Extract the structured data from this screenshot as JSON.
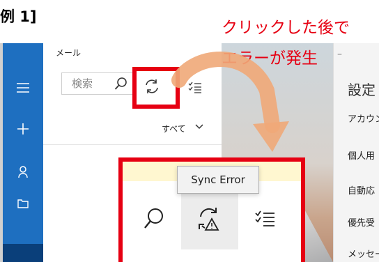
{
  "heading": {
    "text": "例 1]"
  },
  "annotation": {
    "line1": "クリックした後で",
    "line2": "エラーが発生"
  },
  "app": {
    "name": "メール",
    "search": {
      "placeholder": "検索"
    },
    "filter": {
      "label": "すべて"
    }
  },
  "rail": {
    "items": [
      {
        "icon": "hamburger-menu-icon"
      },
      {
        "icon": "plus-icon"
      },
      {
        "icon": "person-icon"
      },
      {
        "icon": "folder-icon"
      }
    ]
  },
  "window": {
    "minimize": "–"
  },
  "settings": {
    "title": "設定",
    "items": [
      "アカウン",
      "個人用",
      "自動応",
      "優先受",
      "メッセー"
    ]
  },
  "zoom": {
    "tooltip": "Sync Error"
  },
  "colors": {
    "annotation_red": "#e60012",
    "rail_blue": "#1e6fc0",
    "arrow_orange": "#f0a878"
  }
}
